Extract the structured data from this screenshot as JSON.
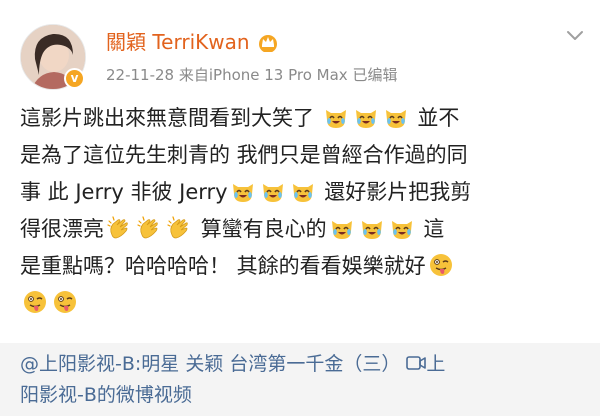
{
  "post": {
    "username": "關穎 TerriKwan",
    "meta": "22-11-28  来自iPhone 13 Pro Max  已编辑",
    "badge_glyph": "v",
    "content": {
      "line1_text": "這影片跳出來無意間看到大笑了",
      "line1_tail": "並不",
      "line2": "是為了這位先生刺青的 我們只是曾經合作過的同",
      "line3_head": "事 此 Jerry 非彼 Jerry",
      "line3_tail": "還好影片把我剪",
      "line4_head": "得很漂亮",
      "line4_mid": "算蠻有良心的",
      "line4_tail": "這",
      "line5_text": "是重點嗎？哈哈哈哈！ 其餘的看看娛樂就好"
    }
  },
  "shared": {
    "line1_text": "@上阳影视-B:明星 关颖 台湾第一千金（三）",
    "line1_tail": "上",
    "line2_text": "阳影视-B的微博视频"
  },
  "colors": {
    "username": "#e2631e",
    "meta": "#8a8a8a",
    "link": "#4a6b95",
    "share_bg": "#f4f4f4",
    "emoji_yellow": "#f7c23a"
  }
}
